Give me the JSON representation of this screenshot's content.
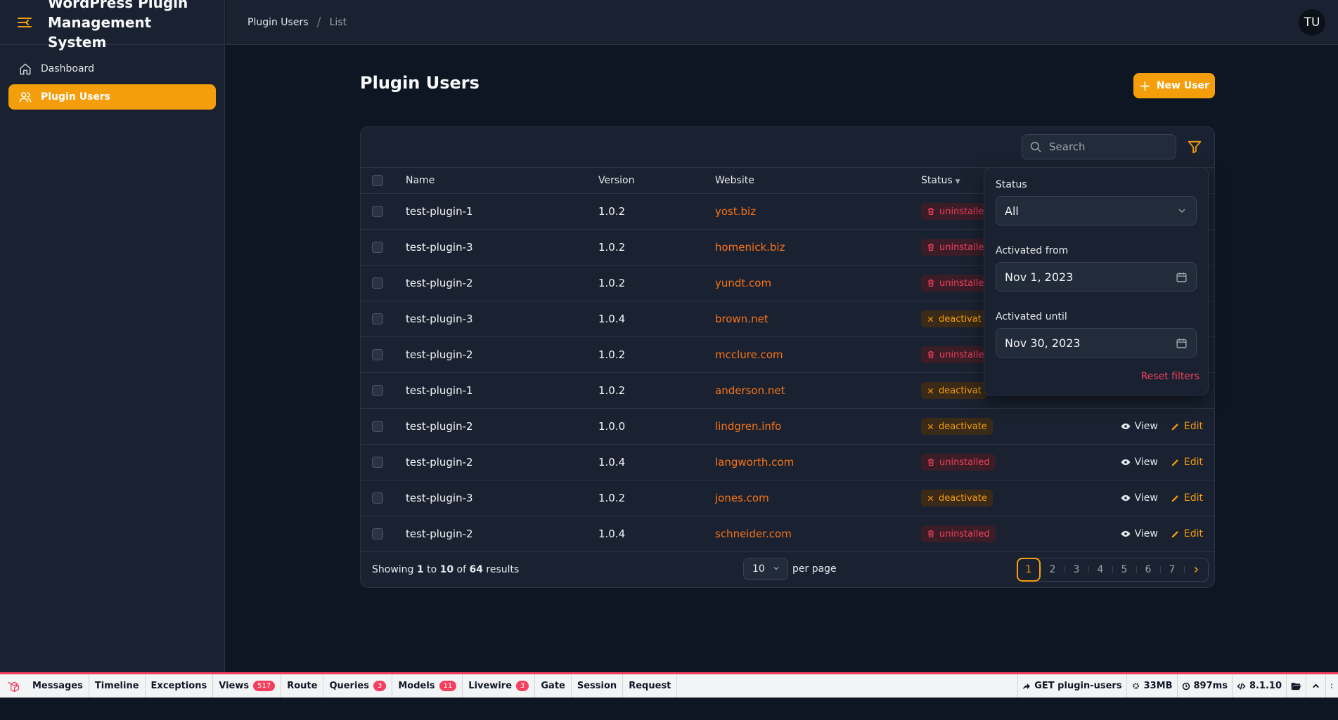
{
  "app": {
    "title": "WordPress Plugin Management System"
  },
  "sidebar": {
    "items": [
      {
        "label": "Dashboard",
        "icon": "home-icon",
        "active": false
      },
      {
        "label": "Plugin Users",
        "icon": "users-icon",
        "active": true
      }
    ]
  },
  "breadcrumb": {
    "first": "Plugin Users",
    "second": "List"
  },
  "user": {
    "initials": "TU"
  },
  "page": {
    "title": "Plugin Users",
    "new_button": "New User"
  },
  "table": {
    "search_placeholder": "Search",
    "columns": {
      "name": "Name",
      "version": "Version",
      "website": "Website",
      "status": "Status"
    },
    "rows": [
      {
        "name": "test-plugin-1",
        "version": "1.0.2",
        "website": "yost.biz",
        "status": "uninstalle",
        "status_type": "uninstalled"
      },
      {
        "name": "test-plugin-3",
        "version": "1.0.2",
        "website": "homenick.biz",
        "status": "uninstalle",
        "status_type": "uninstalled"
      },
      {
        "name": "test-plugin-2",
        "version": "1.0.2",
        "website": "yundt.com",
        "status": "uninstalle",
        "status_type": "uninstalled"
      },
      {
        "name": "test-plugin-3",
        "version": "1.0.4",
        "website": "brown.net",
        "status": "deactivat",
        "status_type": "deactivate"
      },
      {
        "name": "test-plugin-2",
        "version": "1.0.2",
        "website": "mcclure.com",
        "status": "uninstalle",
        "status_type": "uninstalled"
      },
      {
        "name": "test-plugin-1",
        "version": "1.0.2",
        "website": "anderson.net",
        "status": "deactivat",
        "status_type": "deactivate"
      },
      {
        "name": "test-plugin-2",
        "version": "1.0.0",
        "website": "lindgren.info",
        "status": "deactivate",
        "status_type": "deactivate"
      },
      {
        "name": "test-plugin-2",
        "version": "1.0.4",
        "website": "langworth.com",
        "status": "uninstalled",
        "status_type": "uninstalled"
      },
      {
        "name": "test-plugin-3",
        "version": "1.0.2",
        "website": "jones.com",
        "status": "deactivate",
        "status_type": "deactivate"
      },
      {
        "name": "test-plugin-2",
        "version": "1.0.4",
        "website": "schneider.com",
        "status": "uninstalled",
        "status_type": "uninstalled"
      }
    ],
    "actions": {
      "view": "View",
      "edit": "Edit"
    },
    "footer": {
      "showing_prefix": "Showing ",
      "from": "1",
      "to_word": " to ",
      "to": "10",
      "of_word": " of ",
      "total": "64",
      "results_word": " results",
      "per_page_value": "10",
      "per_page_label": "per page",
      "pages": [
        "1",
        "2",
        "3",
        "4",
        "5",
        "6",
        "7"
      ],
      "current_page": "1"
    }
  },
  "filters": {
    "status_label": "Status",
    "status_value": "All",
    "from_label": "Activated from",
    "from_value": "Nov 1, 2023",
    "until_label": "Activated until",
    "until_value": "Nov 30, 2023",
    "reset_label": "Reset filters"
  },
  "debugbar": {
    "tabs": [
      {
        "label": "Messages",
        "count": ""
      },
      {
        "label": "Timeline",
        "count": ""
      },
      {
        "label": "Exceptions",
        "count": ""
      },
      {
        "label": "Views",
        "count": "517"
      },
      {
        "label": "Route",
        "count": ""
      },
      {
        "label": "Queries",
        "count": "3"
      },
      {
        "label": "Models",
        "count": "11"
      },
      {
        "label": "Livewire",
        "count": "3"
      },
      {
        "label": "Gate",
        "count": ""
      },
      {
        "label": "Session",
        "count": ""
      },
      {
        "label": "Request",
        "count": ""
      }
    ],
    "route": "GET plugin-users",
    "memory": "33MB",
    "time": "897ms",
    "php": "8.1.10"
  },
  "colors": {
    "accent": "#f59e0b",
    "danger": "#f43f5e",
    "link": "#f97316"
  }
}
